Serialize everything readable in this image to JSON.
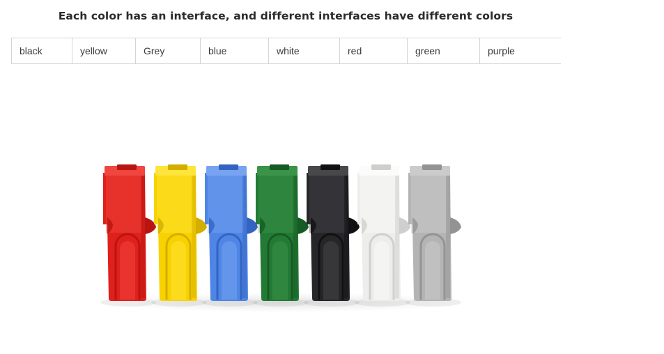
{
  "heading": "Each color has an interface, and different interfaces have different colors",
  "colors_row": [
    "black",
    "yellow",
    "Grey",
    "blue",
    "white",
    "red",
    "green",
    "purple"
  ],
  "photo": {
    "subject": "connector-housings",
    "housings": [
      {
        "name": "red-connector",
        "color": "#e0201c",
        "shade": "#b81512",
        "light": "#f0463f"
      },
      {
        "name": "yellow-connector",
        "color": "#f8d200",
        "shade": "#d3ae00",
        "light": "#ffe43a"
      },
      {
        "name": "blue-connector",
        "color": "#4f86e6",
        "shade": "#3464c2",
        "light": "#78a3f0"
      },
      {
        "name": "green-connector",
        "color": "#237a35",
        "shade": "#165a24",
        "light": "#3b9249"
      },
      {
        "name": "black-connector",
        "color": "#262628",
        "shade": "#111113",
        "light": "#48484b"
      },
      {
        "name": "white-connector",
        "color": "#ededeb",
        "shade": "#cfcfcd",
        "light": "#fbfbf9"
      },
      {
        "name": "grey-connector",
        "color": "#b4b4b4",
        "shade": "#939393",
        "light": "#cbcbcb"
      }
    ]
  }
}
